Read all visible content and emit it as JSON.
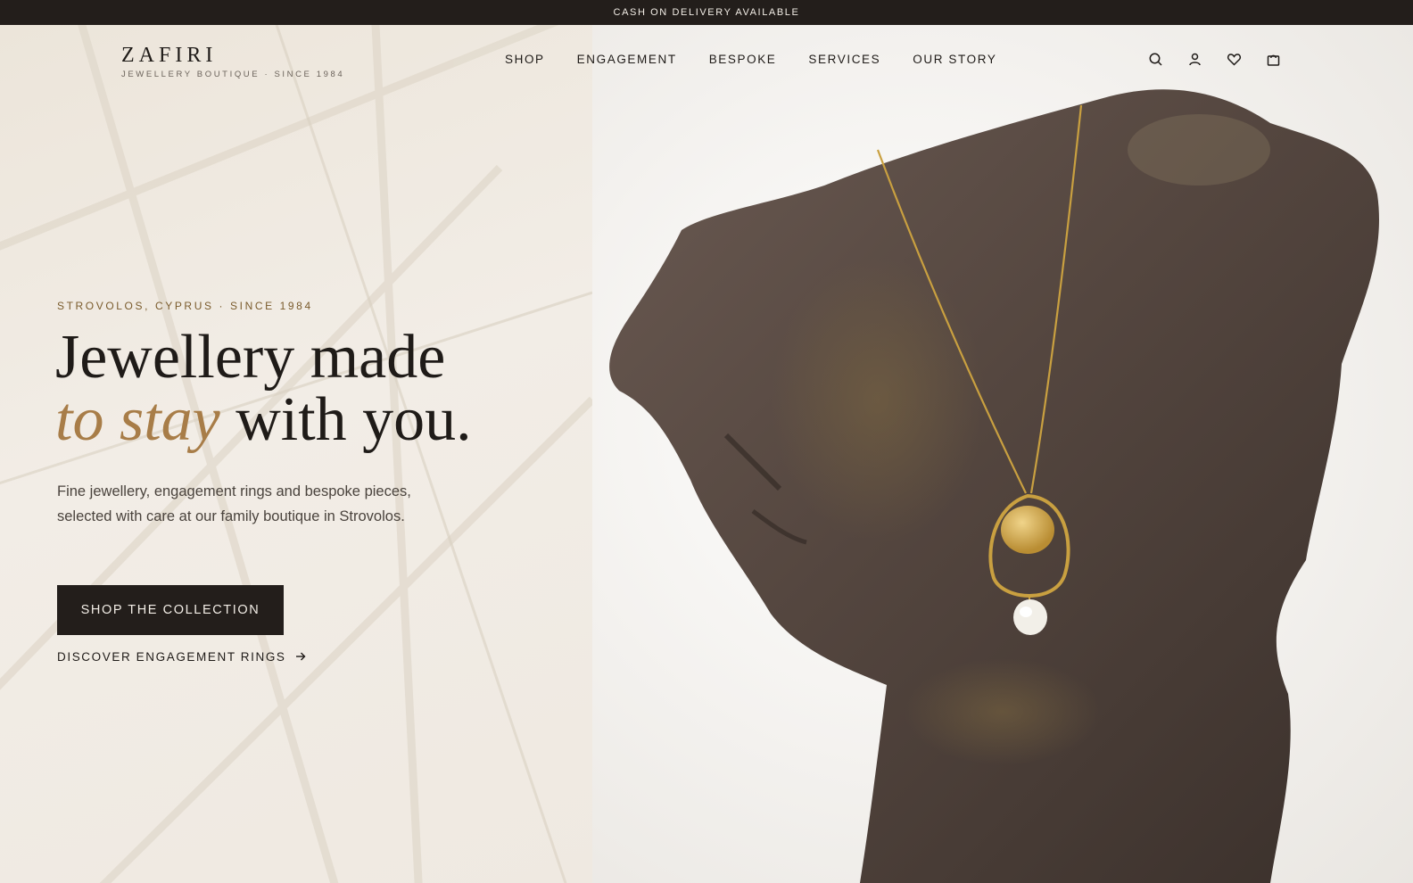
{
  "announcement": "CASH ON DELIVERY AVAILABLE",
  "brand": {
    "name": "ZAFIRI",
    "tagline": "JEWELLERY BOUTIQUE · SINCE 1984"
  },
  "nav": {
    "items": [
      {
        "label": "SHOP"
      },
      {
        "label": "ENGAGEMENT"
      },
      {
        "label": "BESPOKE"
      },
      {
        "label": "SERVICES"
      },
      {
        "label": "OUR STORY"
      }
    ]
  },
  "header_icons": [
    "search-icon",
    "account-icon",
    "wishlist-heart-icon",
    "shopping-bag-icon"
  ],
  "hero": {
    "eyebrow": "STROVOLOS, CYPRUS · SINCE 1984",
    "headline_line1": "Jewellery made",
    "headline_accent": "to stay",
    "headline_rest": " with you.",
    "description": "Fine jewellery, engagement rings and bespoke pieces, selected with care at our family boutique in Strovolos.",
    "primary_cta": "SHOP THE COLLECTION",
    "secondary_link": "DISCOVER ENGAGEMENT RINGS"
  },
  "colors": {
    "dark": "#231e1b",
    "accent_gold": "#a87d48",
    "eyebrow_bronze": "#7a5b2c",
    "background": "#f2ede6"
  }
}
